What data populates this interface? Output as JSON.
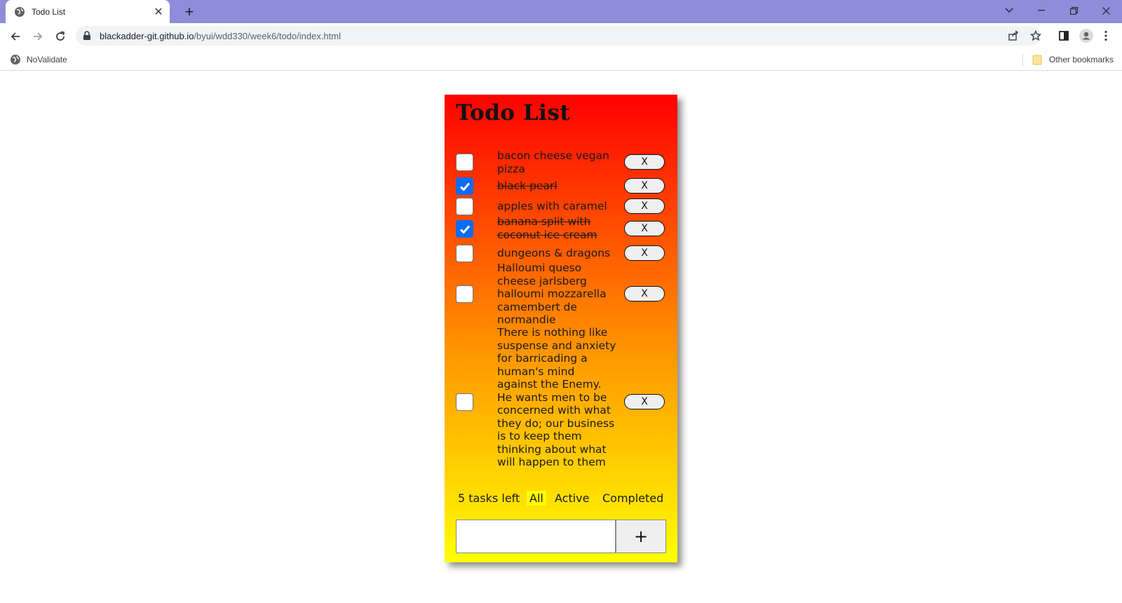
{
  "browser": {
    "tab_title": "Todo List",
    "tab_close": "✕",
    "new_tab": "+",
    "url_host": "blackadder-git.github.io",
    "url_path": "/byui/wdd330/week6/todo/index.html",
    "bookmarks": {
      "left_item": "NoValidate",
      "other": "Other bookmarks"
    },
    "colors": {
      "tabstrip": "#8f8cd9"
    },
    "icons": [
      "back-icon",
      "forward-icon",
      "reload-icon",
      "lock-icon",
      "share-icon",
      "star-icon",
      "side-panel-icon",
      "profile-icon",
      "menu-icon"
    ]
  },
  "app": {
    "title": "Todo List",
    "tasks": [
      {
        "text": "bacon cheese vegan pizza",
        "done": false,
        "delete_label": "X"
      },
      {
        "text": "black pearl",
        "done": true,
        "delete_label": "X"
      },
      {
        "text": "apples with caramel",
        "done": false,
        "delete_label": "X"
      },
      {
        "text": "banana split with coconut ice cream",
        "done": true,
        "delete_label": "X"
      },
      {
        "text": "dungeons & dragons",
        "done": false,
        "delete_label": "X"
      },
      {
        "text": "Halloumi queso cheese jarlsberg halloumi mozzarella camembert de normandie",
        "done": false,
        "delete_label": "X"
      },
      {
        "text": "There is nothing like suspense and anxiety for barricading a human's mind against the Enemy. He wants men to be concerned with what they do; our business is to keep them thinking about what will happen to them",
        "done": false,
        "delete_label": "X"
      }
    ],
    "footer": {
      "tasks_left": "5 tasks left",
      "filter_all": "All",
      "filter_active": "Active",
      "filter_completed": "Completed"
    },
    "add_button": "+",
    "colors": {
      "gradient_top": "#ff0000",
      "gradient_bottom": "#ffff00",
      "checkbox_checked": "#0b6cf2",
      "filter_highlight": "#ffff00"
    }
  }
}
